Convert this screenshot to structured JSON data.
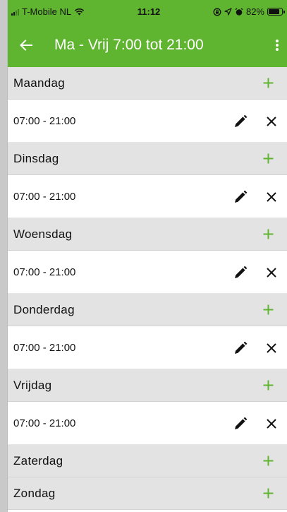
{
  "status_bar": {
    "carrier": "T-Mobile NL",
    "time": "11:12",
    "battery_percent": "82%",
    "battery_level": 0.82,
    "icons": [
      "signal-icon",
      "wifi-icon",
      "screen-lock-icon",
      "location-icon",
      "alarm-icon",
      "battery-icon"
    ]
  },
  "app_bar": {
    "title": "Ma - Vrij 7:00 tot 21:00",
    "back_icon": "arrow-left-icon",
    "menu_icon": "more-vertical-icon"
  },
  "colors": {
    "accent": "#5fb52f",
    "header_bg": "#e3e3e3",
    "add_icon": "#5fb52f"
  },
  "days": [
    {
      "name": "Maandag",
      "slots": [
        {
          "time": "07:00 - 21:00"
        }
      ]
    },
    {
      "name": "Dinsdag",
      "slots": [
        {
          "time": "07:00 - 21:00"
        }
      ]
    },
    {
      "name": "Woensdag",
      "slots": [
        {
          "time": "07:00 - 21:00"
        }
      ]
    },
    {
      "name": "Donderdag",
      "slots": [
        {
          "time": "07:00 - 21:00"
        }
      ]
    },
    {
      "name": "Vrijdag",
      "slots": [
        {
          "time": "07:00 - 21:00"
        }
      ]
    },
    {
      "name": "Zaterdag",
      "slots": []
    },
    {
      "name": "Zondag",
      "slots": []
    }
  ]
}
